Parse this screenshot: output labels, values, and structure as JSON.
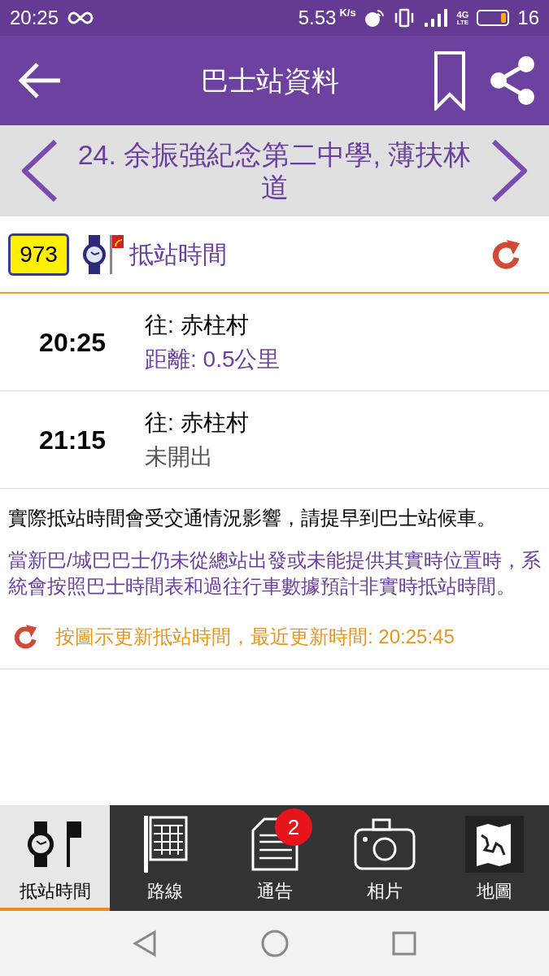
{
  "status_bar": {
    "time": "20:25",
    "speed": "5.53",
    "speed_unit": "K/s",
    "network": "4G",
    "network_sub": "LTE",
    "battery": "16"
  },
  "app_bar": {
    "title": "巴士站資料"
  },
  "stop_header": {
    "title": "24. 余振強紀念第二中學, 薄扶林道"
  },
  "route_row": {
    "route": "973",
    "label": "抵站時間"
  },
  "arrivals": [
    {
      "time": "20:25",
      "destination": "往: 赤柱村",
      "info": "距離: 0.5公里",
      "kind": "live"
    },
    {
      "time": "21:15",
      "destination": "往: 赤柱村",
      "info": "未開出",
      "kind": "scheduled"
    }
  ],
  "notes": [
    {
      "text": "實際抵站時間會受交通情況影響，請提早到巴士站候車。",
      "kind": "plain"
    },
    {
      "text": "當新巴/城巴巴士仍未從總站出發或未能提供其實時位置時，系統會按照巴士時間表和過往行車數據預計非實時抵站時間。",
      "kind": "highlight"
    }
  ],
  "update_line": "按圖示更新抵站時間，最近更新時間: 20:25:45",
  "bottom_nav": [
    {
      "label": "抵站時間",
      "selected": true,
      "kind": "eta"
    },
    {
      "label": "路線",
      "selected": false,
      "kind": "route"
    },
    {
      "label": "通告",
      "selected": false,
      "kind": "notice",
      "badge": "2"
    },
    {
      "label": "相片",
      "selected": false,
      "kind": "photo"
    },
    {
      "label": "地圖",
      "selected": false,
      "kind": "map"
    }
  ]
}
